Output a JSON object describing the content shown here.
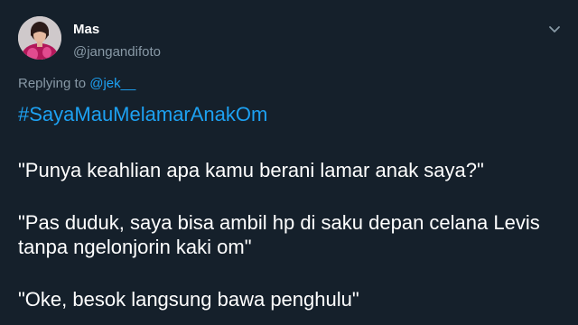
{
  "tweet": {
    "author": {
      "name": "Mas",
      "handle": "@jangandifoto",
      "avatar_icon": "profile-photo-avatar"
    },
    "menu_icon": "chevron-down-icon",
    "replying": {
      "prefix": "Replying to ",
      "mention": "@jek__"
    },
    "hashtag": "#SayaMauMelamarAnakOm",
    "lines": [
      "\"Punya keahlian apa kamu berani lamar anak saya?\"",
      "\"Pas duduk, saya bisa ambil hp di saku depan celana Levis",
      "tanpa ngelonjorin kaki om\"",
      "\"Oke, besok langsung bawa penghulu\""
    ],
    "colors": {
      "background": "#15202b",
      "text": "#ffffff",
      "secondary": "#8899a6",
      "accent": "#1da1f2"
    }
  }
}
